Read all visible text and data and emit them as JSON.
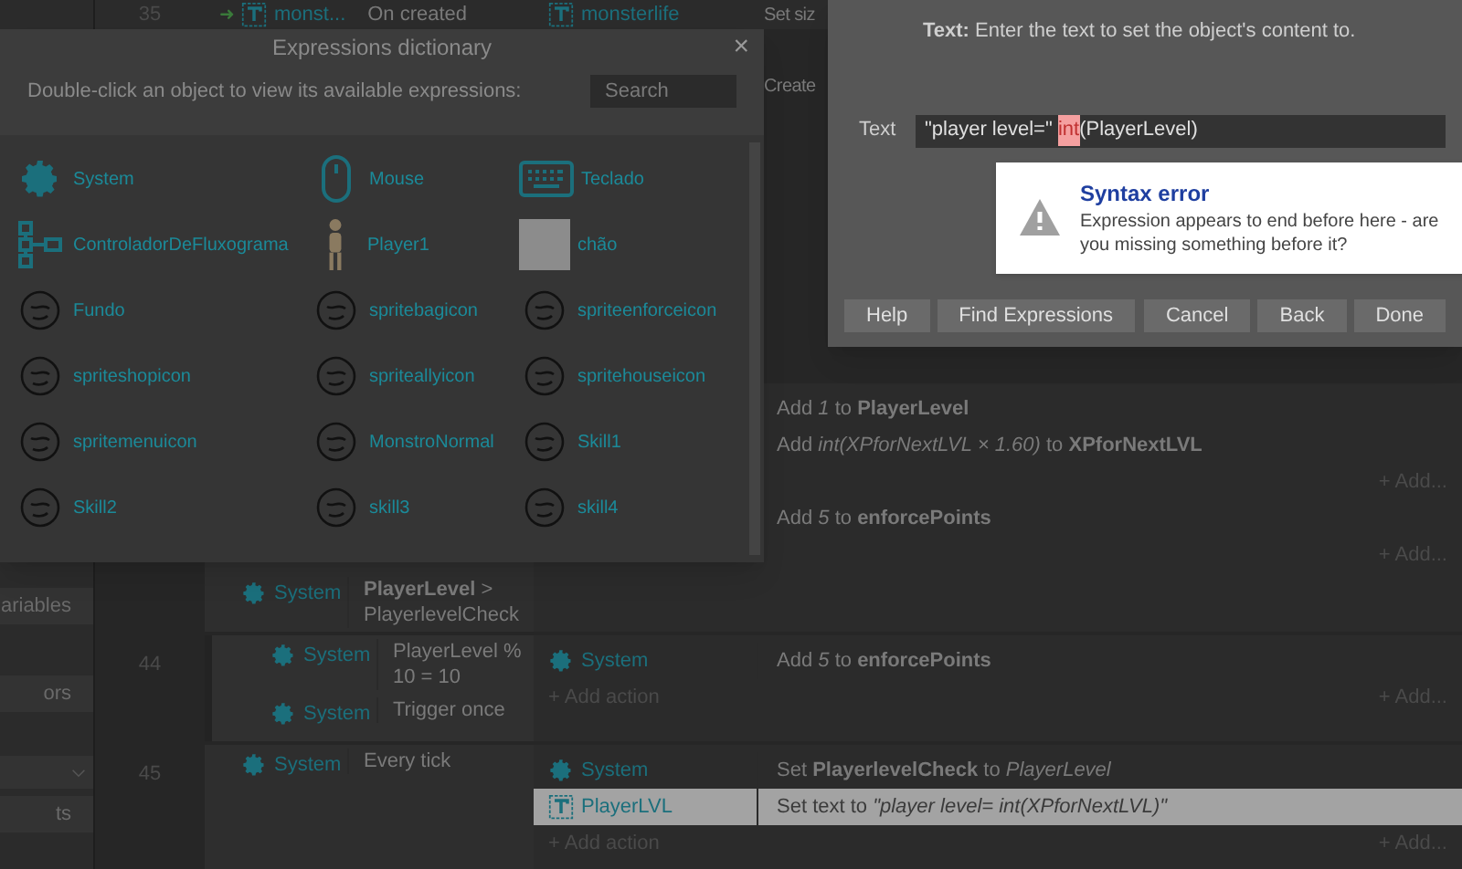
{
  "sidebar": {
    "buttons": [
      {
        "label": "ariables",
        "kind": "button"
      },
      {
        "label": "ors",
        "kind": "button"
      },
      {
        "kind": "dropdown"
      },
      {
        "label": "ts",
        "kind": "button"
      }
    ]
  },
  "event_sheet": {
    "top_row": {
      "number": "35",
      "arrow": "➜",
      "object": "monst...",
      "condition": "On created",
      "action_object": "monsterlife",
      "action": "Set siz"
    },
    "covered_row": {
      "action": "Create"
    },
    "block": {
      "conditions": [
        {
          "object": "System",
          "kind": "system",
          "text": "**PlayerLevel** > PlayerlevelCheck"
        }
      ],
      "actions": [
        {
          "kind": "action",
          "text": "Add *1* to **PlayerLevel**",
          "selected": false
        },
        {
          "kind": "action",
          "text": "Add *int(XPforNextLVL × 1.60)* to **XPforNextLVL**",
          "selected": false
        },
        {
          "kind": "add",
          "right": "+ Add..."
        },
        {
          "kind": "action",
          "text": "Add *5* to **enforcePoints**",
          "selected": false
        },
        {
          "kind": "add",
          "right": "+ Add..."
        }
      ]
    },
    "rows": [
      {
        "number": "44",
        "nested": true,
        "conditions": [
          {
            "object": "System",
            "kind": "system",
            "text": "PlayerLevel % 10 = 10"
          },
          {
            "object": "System",
            "kind": "system",
            "text": "Trigger once"
          }
        ],
        "actions": [
          {
            "kind": "system_action",
            "object": "System",
            "text": "Add *5* to **enforcePoints**",
            "selected": false
          },
          {
            "kind": "add",
            "left": "+ Add action",
            "right": "+ Add..."
          }
        ]
      },
      {
        "number": "45",
        "nested": false,
        "conditions": [
          {
            "object": "System",
            "kind": "system",
            "text": "Every tick"
          }
        ],
        "actions": [
          {
            "kind": "system_action",
            "object": "System",
            "text": "Set **PlayerlevelCheck** to *PlayerLevel*",
            "selected": false
          },
          {
            "kind": "text_action",
            "object": "PlayerLVL",
            "text": "Set text to *\"player level= int(XPforNextLVL)\"*",
            "selected": true
          },
          {
            "kind": "add",
            "left": "+ Add action",
            "right": "+ Add..."
          }
        ]
      }
    ]
  },
  "expressions_dictionary": {
    "title": "Expressions dictionary",
    "close": "×",
    "instruction": "Double-click an object to view its available expressions:",
    "search": {
      "placeholder": "Search"
    },
    "objects": [
      {
        "name": "System",
        "kind": "gear"
      },
      {
        "name": "Mouse",
        "kind": "mouse"
      },
      {
        "name": "Teclado",
        "kind": "keyboard"
      },
      {
        "name": "ControladorDeFluxograma",
        "kind": "flowchart"
      },
      {
        "name": "Player1",
        "kind": "figure"
      },
      {
        "name": "chão",
        "kind": "square"
      },
      {
        "name": "Fundo",
        "kind": "sketch"
      },
      {
        "name": "spritebagicon",
        "kind": "sketch"
      },
      {
        "name": "spriteenforceicon",
        "kind": "sketch"
      },
      {
        "name": "spriteshopicon",
        "kind": "sketch"
      },
      {
        "name": "spriteallyicon",
        "kind": "sketch"
      },
      {
        "name": "spritehouseicon",
        "kind": "sketch"
      },
      {
        "name": "spritemenuicon",
        "kind": "sketch"
      },
      {
        "name": "MonstroNormal",
        "kind": "sketch"
      },
      {
        "name": "Skill1",
        "kind": "sketch"
      },
      {
        "name": "Skill2",
        "kind": "sketch"
      },
      {
        "name": "skill3",
        "kind": "sketch"
      },
      {
        "name": "skill4",
        "kind": "sketch"
      }
    ]
  },
  "parameter_dialog": {
    "description": "**Text:** Enter the text to set the object's content to.",
    "field": {
      "label": "Text",
      "segments": [
        {
          "text": "\"player level=\" ",
          "error": false
        },
        {
          "text": "int",
          "error": true
        },
        {
          "text": "(PlayerLevel)",
          "error": false
        }
      ]
    },
    "error_tooltip": {
      "title": "Syntax error",
      "message": "Expression appears to end before here - are you missing something before it?"
    },
    "buttons": [
      {
        "label": "Help",
        "kind": "left"
      },
      {
        "label": "Find Expressions",
        "kind": "left"
      },
      {
        "label": "Cancel",
        "kind": "right"
      },
      {
        "label": "Back",
        "kind": "right"
      },
      {
        "label": "Done",
        "kind": "right"
      }
    ]
  }
}
